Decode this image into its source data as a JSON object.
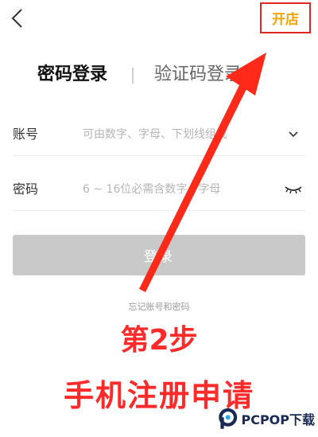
{
  "header": {
    "open_store_label": "开店"
  },
  "tabs": [
    {
      "label": "密码登录",
      "active": true
    },
    {
      "label": "验证码登录",
      "active": false
    }
  ],
  "form": {
    "account": {
      "label": "账号",
      "placeholder": "可由数字、字母、下划线组成"
    },
    "password": {
      "label": "密码",
      "placeholder": "6 ~ 16位必需含数字、字母"
    },
    "login_label": "登录",
    "forgot_label": "忘记账号和密码"
  },
  "overlay": {
    "step": "第2步",
    "caption": "手机注册申请",
    "watermark": "PCPOP下载"
  },
  "colors": {
    "accent": "#f5a300",
    "highlight": "#e0271f",
    "button_disabled": "#c9c9c9"
  }
}
